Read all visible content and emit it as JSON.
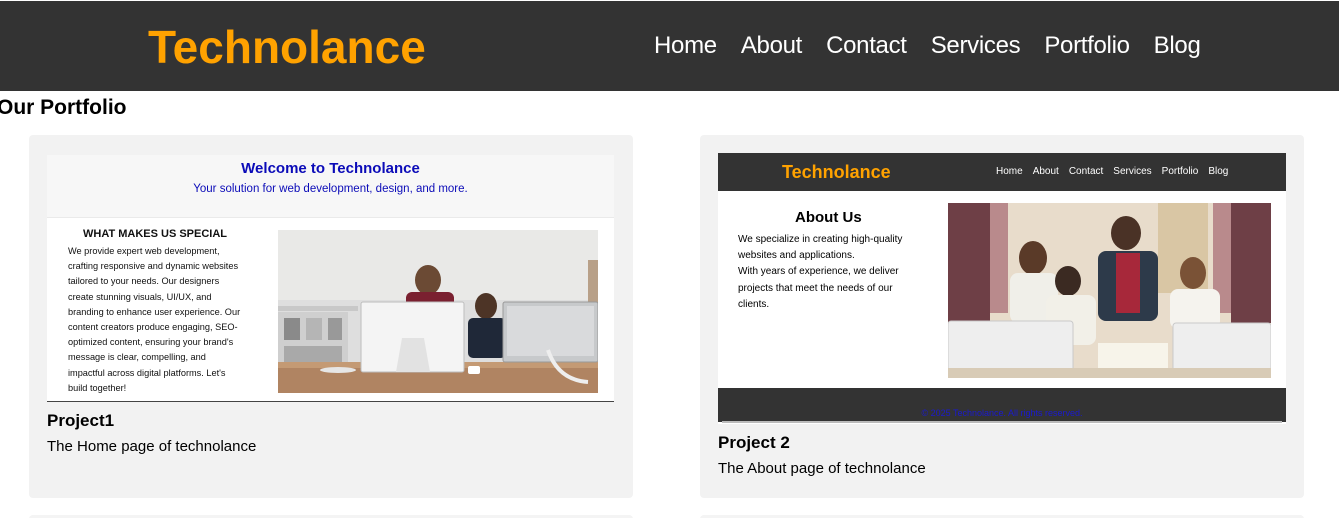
{
  "header": {
    "logo": "Technolance",
    "nav": [
      "Home",
      "About",
      "Contact",
      "Services",
      "Portfolio",
      "Blog"
    ]
  },
  "section_title": "Our Portfolio",
  "projects": [
    {
      "title": "Project1",
      "description": "The Home page of technolance",
      "thumbnail": {
        "welcome": "Welcome to Technolance",
        "subtitle": "Your solution for web development, design, and more.",
        "heading": "WHAT MAKES US SPECIAL",
        "lines": [
          "We provide expert web development,",
          "crafting responsive and dynamic websites",
          "tailored to your needs. Our designers",
          "create stunning visuals, UI/UX, and",
          "branding to enhance user experience. Our",
          "content creators produce engaging, SEO-",
          "optimized content, ensuring your brand's",
          "message is clear, compelling, and",
          "impactful across digital platforms. Let's",
          "build together!"
        ]
      }
    },
    {
      "title": "Project 2",
      "description": "The About page of technolance",
      "thumbnail": {
        "logo": "Technolance",
        "nav": [
          "Home",
          "About",
          "Contact",
          "Services",
          "Portfolio",
          "Blog"
        ],
        "heading": "About Us",
        "lines": [
          "We specialize in creating high-quality",
          "websites and applications.",
          "With years of experience, we deliver",
          "projects that meet the needs of our",
          "clients."
        ],
        "footer": "© 2025 Technolance. All rights reserved."
      }
    }
  ],
  "colors": {
    "header_bg": "#333333",
    "brand_orange": "#ffa200",
    "card_bg": "#f2f2f2",
    "link_blue": "#0b0bb8"
  }
}
